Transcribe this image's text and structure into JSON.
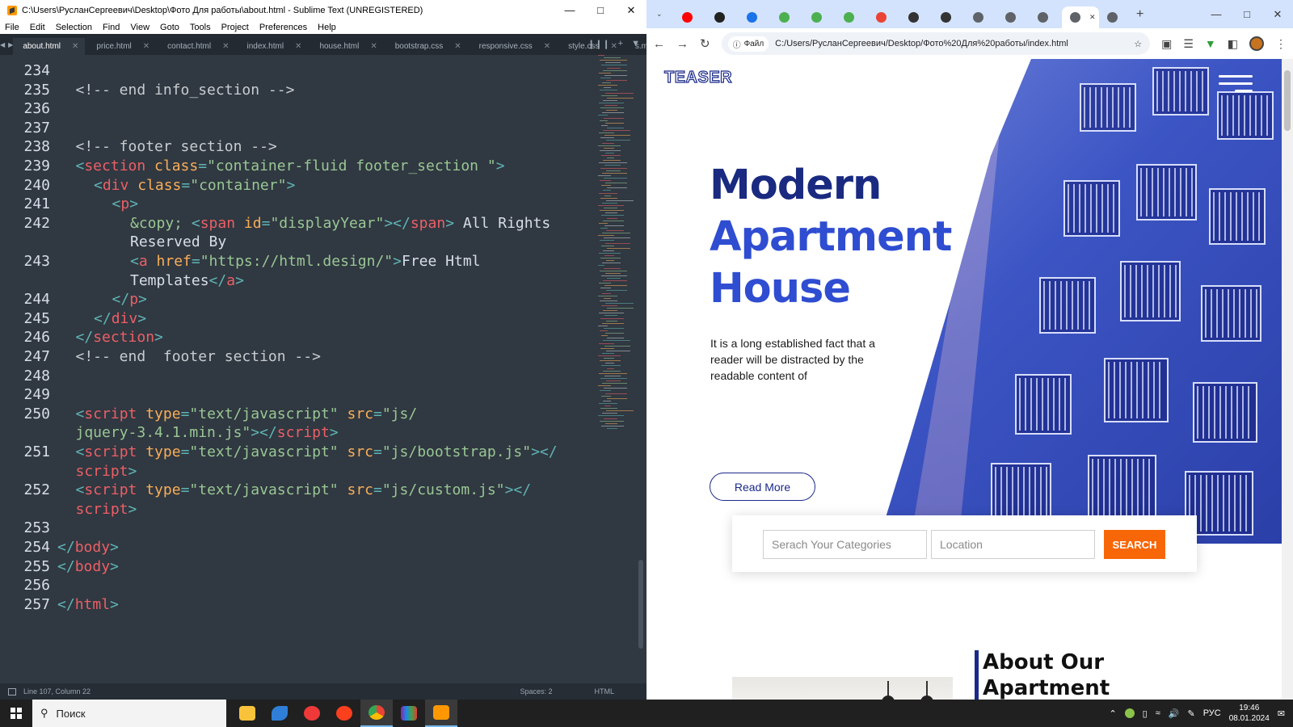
{
  "sublime": {
    "title": "C:\\Users\\РусланСергеевич\\Desktop\\Фото Для работы\\about.html - Sublime Text (UNREGISTERED)",
    "menu": [
      "File",
      "Edit",
      "Selection",
      "Find",
      "View",
      "Goto",
      "Tools",
      "Project",
      "Preferences",
      "Help"
    ],
    "tabs": [
      "about.html",
      "price.html",
      "contact.html",
      "index.html",
      "house.html",
      "bootstrap.css",
      "responsive.css",
      "style.css",
      "s.map"
    ],
    "active_tab": "about.html",
    "line_numbers": [
      "234",
      "235",
      "236",
      "237",
      "238",
      "239",
      "240",
      "241",
      "242",
      "",
      "243",
      "",
      "244",
      "245",
      "246",
      "247",
      "248",
      "249",
      "250",
      "",
      "251",
      "",
      "252",
      "",
      "253",
      "254",
      "255",
      "256",
      "257"
    ],
    "status": {
      "position": "Line 107, Column 22",
      "indent": "Spaces: 2",
      "syntax": "HTML"
    }
  },
  "code_lines": [
    {
      "seg": []
    },
    {
      "seg": [
        {
          "t": "c-com",
          "v": "<!-- end info_section -->"
        }
      ],
      "indent": 1
    },
    {
      "seg": []
    },
    {
      "seg": []
    },
    {
      "seg": [
        {
          "t": "c-com",
          "v": "<!-- footer section -->"
        }
      ],
      "indent": 1
    },
    {
      "seg": [
        {
          "t": "c-punc",
          "v": "<"
        },
        {
          "t": "c-tag",
          "v": "section"
        },
        {
          "t": "c-attr",
          "v": " class"
        },
        {
          "t": "c-punc",
          "v": "="
        },
        {
          "t": "c-str",
          "v": "\"container-fluid footer_section \""
        },
        {
          "t": "c-punc",
          "v": ">"
        }
      ],
      "indent": 1
    },
    {
      "seg": [
        {
          "t": "c-punc",
          "v": "<"
        },
        {
          "t": "c-tag",
          "v": "div"
        },
        {
          "t": "c-attr",
          "v": " class"
        },
        {
          "t": "c-punc",
          "v": "="
        },
        {
          "t": "c-str",
          "v": "\"container\""
        },
        {
          "t": "c-punc",
          "v": ">"
        }
      ],
      "indent": 2
    },
    {
      "seg": [
        {
          "t": "c-punc",
          "v": "<"
        },
        {
          "t": "c-tag",
          "v": "p"
        },
        {
          "t": "c-punc",
          "v": ">"
        }
      ],
      "indent": 3
    },
    {
      "seg": [
        {
          "t": "c-str",
          "v": "&copy;"
        },
        {
          "t": "c-txt",
          "v": " "
        },
        {
          "t": "c-punc",
          "v": "<"
        },
        {
          "t": "c-tag",
          "v": "span"
        },
        {
          "t": "c-attr",
          "v": " id"
        },
        {
          "t": "c-punc",
          "v": "="
        },
        {
          "t": "c-str",
          "v": "\"displayYear\""
        },
        {
          "t": "c-punc",
          "v": "></"
        },
        {
          "t": "c-tag",
          "v": "span"
        },
        {
          "t": "c-punc",
          "v": ">"
        },
        {
          "t": "c-txt",
          "v": " All Rights"
        }
      ],
      "indent": 4
    },
    {
      "seg": [
        {
          "t": "c-txt",
          "v": "Reserved By"
        }
      ],
      "indent": 4
    },
    {
      "seg": [
        {
          "t": "c-punc",
          "v": "<"
        },
        {
          "t": "c-tag",
          "v": "a"
        },
        {
          "t": "c-attr",
          "v": " href"
        },
        {
          "t": "c-punc",
          "v": "="
        },
        {
          "t": "c-str",
          "v": "\"https://html.design/\""
        },
        {
          "t": "c-punc",
          "v": ">"
        },
        {
          "t": "c-txt",
          "v": "Free Html"
        }
      ],
      "indent": 4
    },
    {
      "seg": [
        {
          "t": "c-txt",
          "v": "Templates"
        },
        {
          "t": "c-punc",
          "v": "</"
        },
        {
          "t": "c-tag",
          "v": "a"
        },
        {
          "t": "c-punc",
          "v": ">"
        }
      ],
      "indent": 4
    },
    {
      "seg": [
        {
          "t": "c-punc",
          "v": "</"
        },
        {
          "t": "c-tag",
          "v": "p"
        },
        {
          "t": "c-punc",
          "v": ">"
        }
      ],
      "indent": 3
    },
    {
      "seg": [
        {
          "t": "c-punc",
          "v": "</"
        },
        {
          "t": "c-tag",
          "v": "div"
        },
        {
          "t": "c-punc",
          "v": ">"
        }
      ],
      "indent": 2
    },
    {
      "seg": [
        {
          "t": "c-punc",
          "v": "</"
        },
        {
          "t": "c-tag",
          "v": "section"
        },
        {
          "t": "c-punc",
          "v": ">"
        }
      ],
      "indent": 1
    },
    {
      "seg": [
        {
          "t": "c-com",
          "v": "<!-- end  footer section -->"
        }
      ],
      "indent": 1
    },
    {
      "seg": []
    },
    {
      "seg": []
    },
    {
      "seg": [
        {
          "t": "c-punc",
          "v": "<"
        },
        {
          "t": "c-tag",
          "v": "script"
        },
        {
          "t": "c-attr",
          "v": " type"
        },
        {
          "t": "c-punc",
          "v": "="
        },
        {
          "t": "c-str",
          "v": "\"text/javascript\""
        },
        {
          "t": "c-attr",
          "v": " src"
        },
        {
          "t": "c-punc",
          "v": "="
        },
        {
          "t": "c-str",
          "v": "\"js/"
        }
      ],
      "indent": 1
    },
    {
      "seg": [
        {
          "t": "c-str",
          "v": "jquery-3.4.1.min.js\""
        },
        {
          "t": "c-punc",
          "v": "></"
        },
        {
          "t": "c-tag",
          "v": "script"
        },
        {
          "t": "c-punc",
          "v": ">"
        }
      ],
      "indent": 1
    },
    {
      "seg": [
        {
          "t": "c-punc",
          "v": "<"
        },
        {
          "t": "c-tag",
          "v": "script"
        },
        {
          "t": "c-attr",
          "v": " type"
        },
        {
          "t": "c-punc",
          "v": "="
        },
        {
          "t": "c-str",
          "v": "\"text/javascript\""
        },
        {
          "t": "c-attr",
          "v": " src"
        },
        {
          "t": "c-punc",
          "v": "="
        },
        {
          "t": "c-str",
          "v": "\"js/bootstrap.js\""
        },
        {
          "t": "c-punc",
          "v": "></"
        }
      ],
      "indent": 1
    },
    {
      "seg": [
        {
          "t": "c-tag",
          "v": "script"
        },
        {
          "t": "c-punc",
          "v": ">"
        }
      ],
      "indent": 1
    },
    {
      "seg": [
        {
          "t": "c-punc",
          "v": "<"
        },
        {
          "t": "c-tag",
          "v": "script"
        },
        {
          "t": "c-attr",
          "v": " type"
        },
        {
          "t": "c-punc",
          "v": "="
        },
        {
          "t": "c-str",
          "v": "\"text/javascript\""
        },
        {
          "t": "c-attr",
          "v": " src"
        },
        {
          "t": "c-punc",
          "v": "="
        },
        {
          "t": "c-str",
          "v": "\"js/custom.js\""
        },
        {
          "t": "c-punc",
          "v": "></"
        }
      ],
      "indent": 1
    },
    {
      "seg": [
        {
          "t": "c-tag",
          "v": "script"
        },
        {
          "t": "c-punc",
          "v": ">"
        }
      ],
      "indent": 1
    },
    {
      "seg": []
    },
    {
      "seg": [
        {
          "t": "c-punc",
          "v": "</"
        },
        {
          "t": "c-tag",
          "v": "body"
        },
        {
          "t": "c-punc",
          "v": ">"
        }
      ],
      "indent": 0
    },
    {
      "seg": [
        {
          "t": "c-punc",
          "v": "</"
        },
        {
          "t": "c-tag",
          "v": "body"
        },
        {
          "t": "c-punc",
          "v": ">"
        }
      ],
      "indent": 0
    },
    {
      "seg": []
    },
    {
      "seg": [
        {
          "t": "c-punc",
          "v": "</"
        },
        {
          "t": "c-tag",
          "v": "html"
        },
        {
          "t": "c-punc",
          "v": ">"
        }
      ],
      "indent": 0
    }
  ],
  "browser": {
    "tabs": [
      {
        "icon": "youtube-icon",
        "color": "#ff0000"
      },
      {
        "icon": "site-icon",
        "color": "#222222"
      },
      {
        "icon": "download-icon",
        "color": "#1a73e8"
      },
      {
        "icon": "frog-icon",
        "color": "#4caf50"
      },
      {
        "icon": "frog-icon",
        "color": "#4caf50"
      },
      {
        "icon": "frog-icon",
        "color": "#4caf50"
      },
      {
        "icon": "google-icon",
        "color": "#ea4335"
      },
      {
        "icon": "site-icon",
        "color": "#333333"
      },
      {
        "icon": "site-icon",
        "color": "#333333"
      },
      {
        "icon": "globe-icon",
        "color": "#5f6368"
      },
      {
        "icon": "globe-icon",
        "color": "#5f6368"
      },
      {
        "icon": "globe-icon",
        "color": "#5f6368"
      },
      {
        "icon": "text-icon",
        "color": "#5f6368",
        "active": true
      },
      {
        "icon": "globe-icon",
        "color": "#5f6368"
      }
    ],
    "file_chip": "Файл",
    "url": "C:/Users/РусланСергеевич/Desktop/Фото%20Для%20работы/index.html"
  },
  "webpage": {
    "brand": "TEASER",
    "hero_title": [
      "Modern",
      "Apartment",
      "House"
    ],
    "hero_text": "It is a long established fact that a reader will be distracted by the readable content of",
    "read_more": "Read More",
    "search_categories_placeholder": "Serach Your Categories",
    "location_placeholder": "Location",
    "search_button": "SEARCH",
    "about_title": [
      "About Our",
      "Apartment"
    ],
    "colors": {
      "primary": "#1b2a8a",
      "accent": "#2f4dd1",
      "orange": "#f76707"
    }
  },
  "taskbar": {
    "search_placeholder": "Поиск",
    "language": "РУС",
    "time": "19:46",
    "date": "08.01.2024"
  }
}
